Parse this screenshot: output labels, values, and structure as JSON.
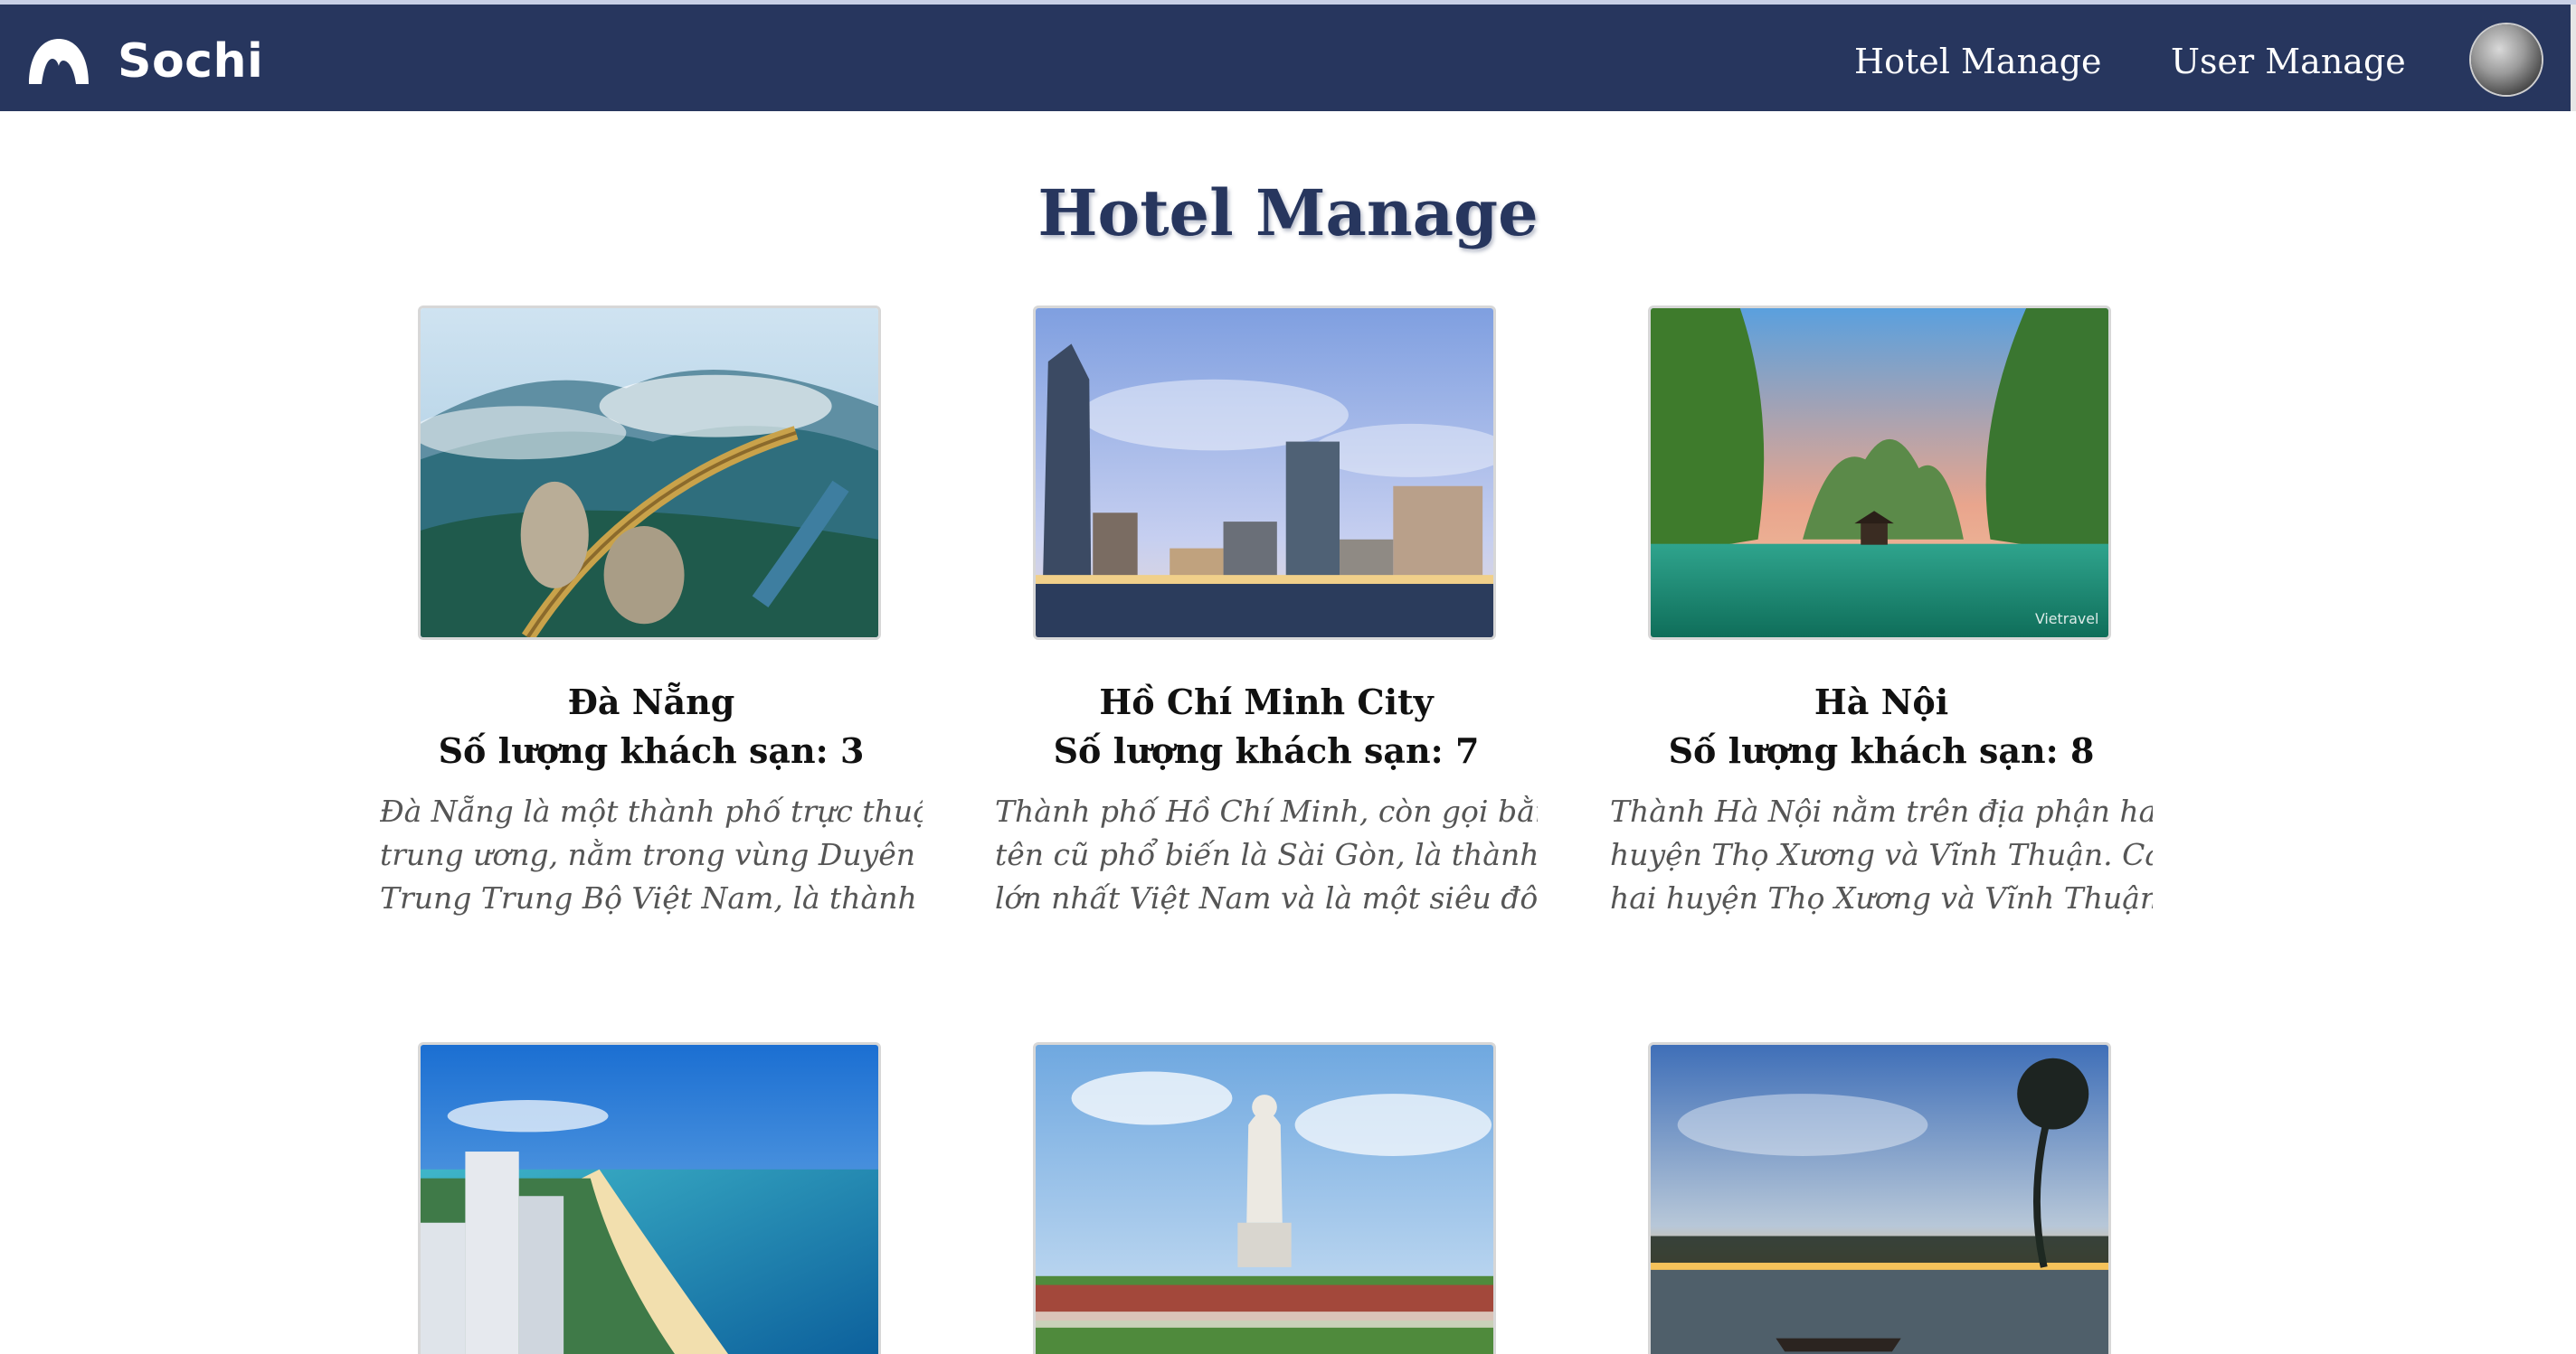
{
  "header": {
    "brand": "Sochi",
    "nav": [
      {
        "label": "Hotel Manage"
      },
      {
        "label": "User Manage"
      }
    ]
  },
  "main": {
    "title": "Hotel Manage",
    "cards": [
      {
        "name": "Đà Nẵng",
        "count": "Số lượng khách sạn: 3",
        "desc": [
          "Đà Nẵng là một thành phố trực thuộc",
          "trung ương, nằm trong vùng Duyên hải",
          "Trung Trung Bộ Việt Nam, là thành ph..."
        ]
      },
      {
        "name": "Hồ Chí Minh City",
        "count": "Số lượng khách sạn: 7",
        "desc": [
          "Thành phố Hồ Chí Minh, còn gọi bằng",
          "tên cũ phổ biến là Sài Gòn, là thành phố",
          "lớn nhất Việt Nam và là một siêu đô th..."
        ]
      },
      {
        "name": "Hà Nội",
        "count": "Số lượng khách sạn: 8",
        "desc": [
          "Thành Hà Nội nằm trên địa phận hai",
          "huyện Thọ Xương và Vĩnh Thuận. Cả",
          "hai huyện Thọ Xương và Vĩnh Thuận..."
        ]
      },
      {
        "name": "",
        "count": "",
        "desc": []
      },
      {
        "name": "",
        "count": "",
        "desc": []
      },
      {
        "name": "",
        "count": "",
        "desc": []
      }
    ]
  },
  "image_watermark": "Vietravel",
  "colors": {
    "navbar": "#27365e",
    "title": "#27365e"
  }
}
